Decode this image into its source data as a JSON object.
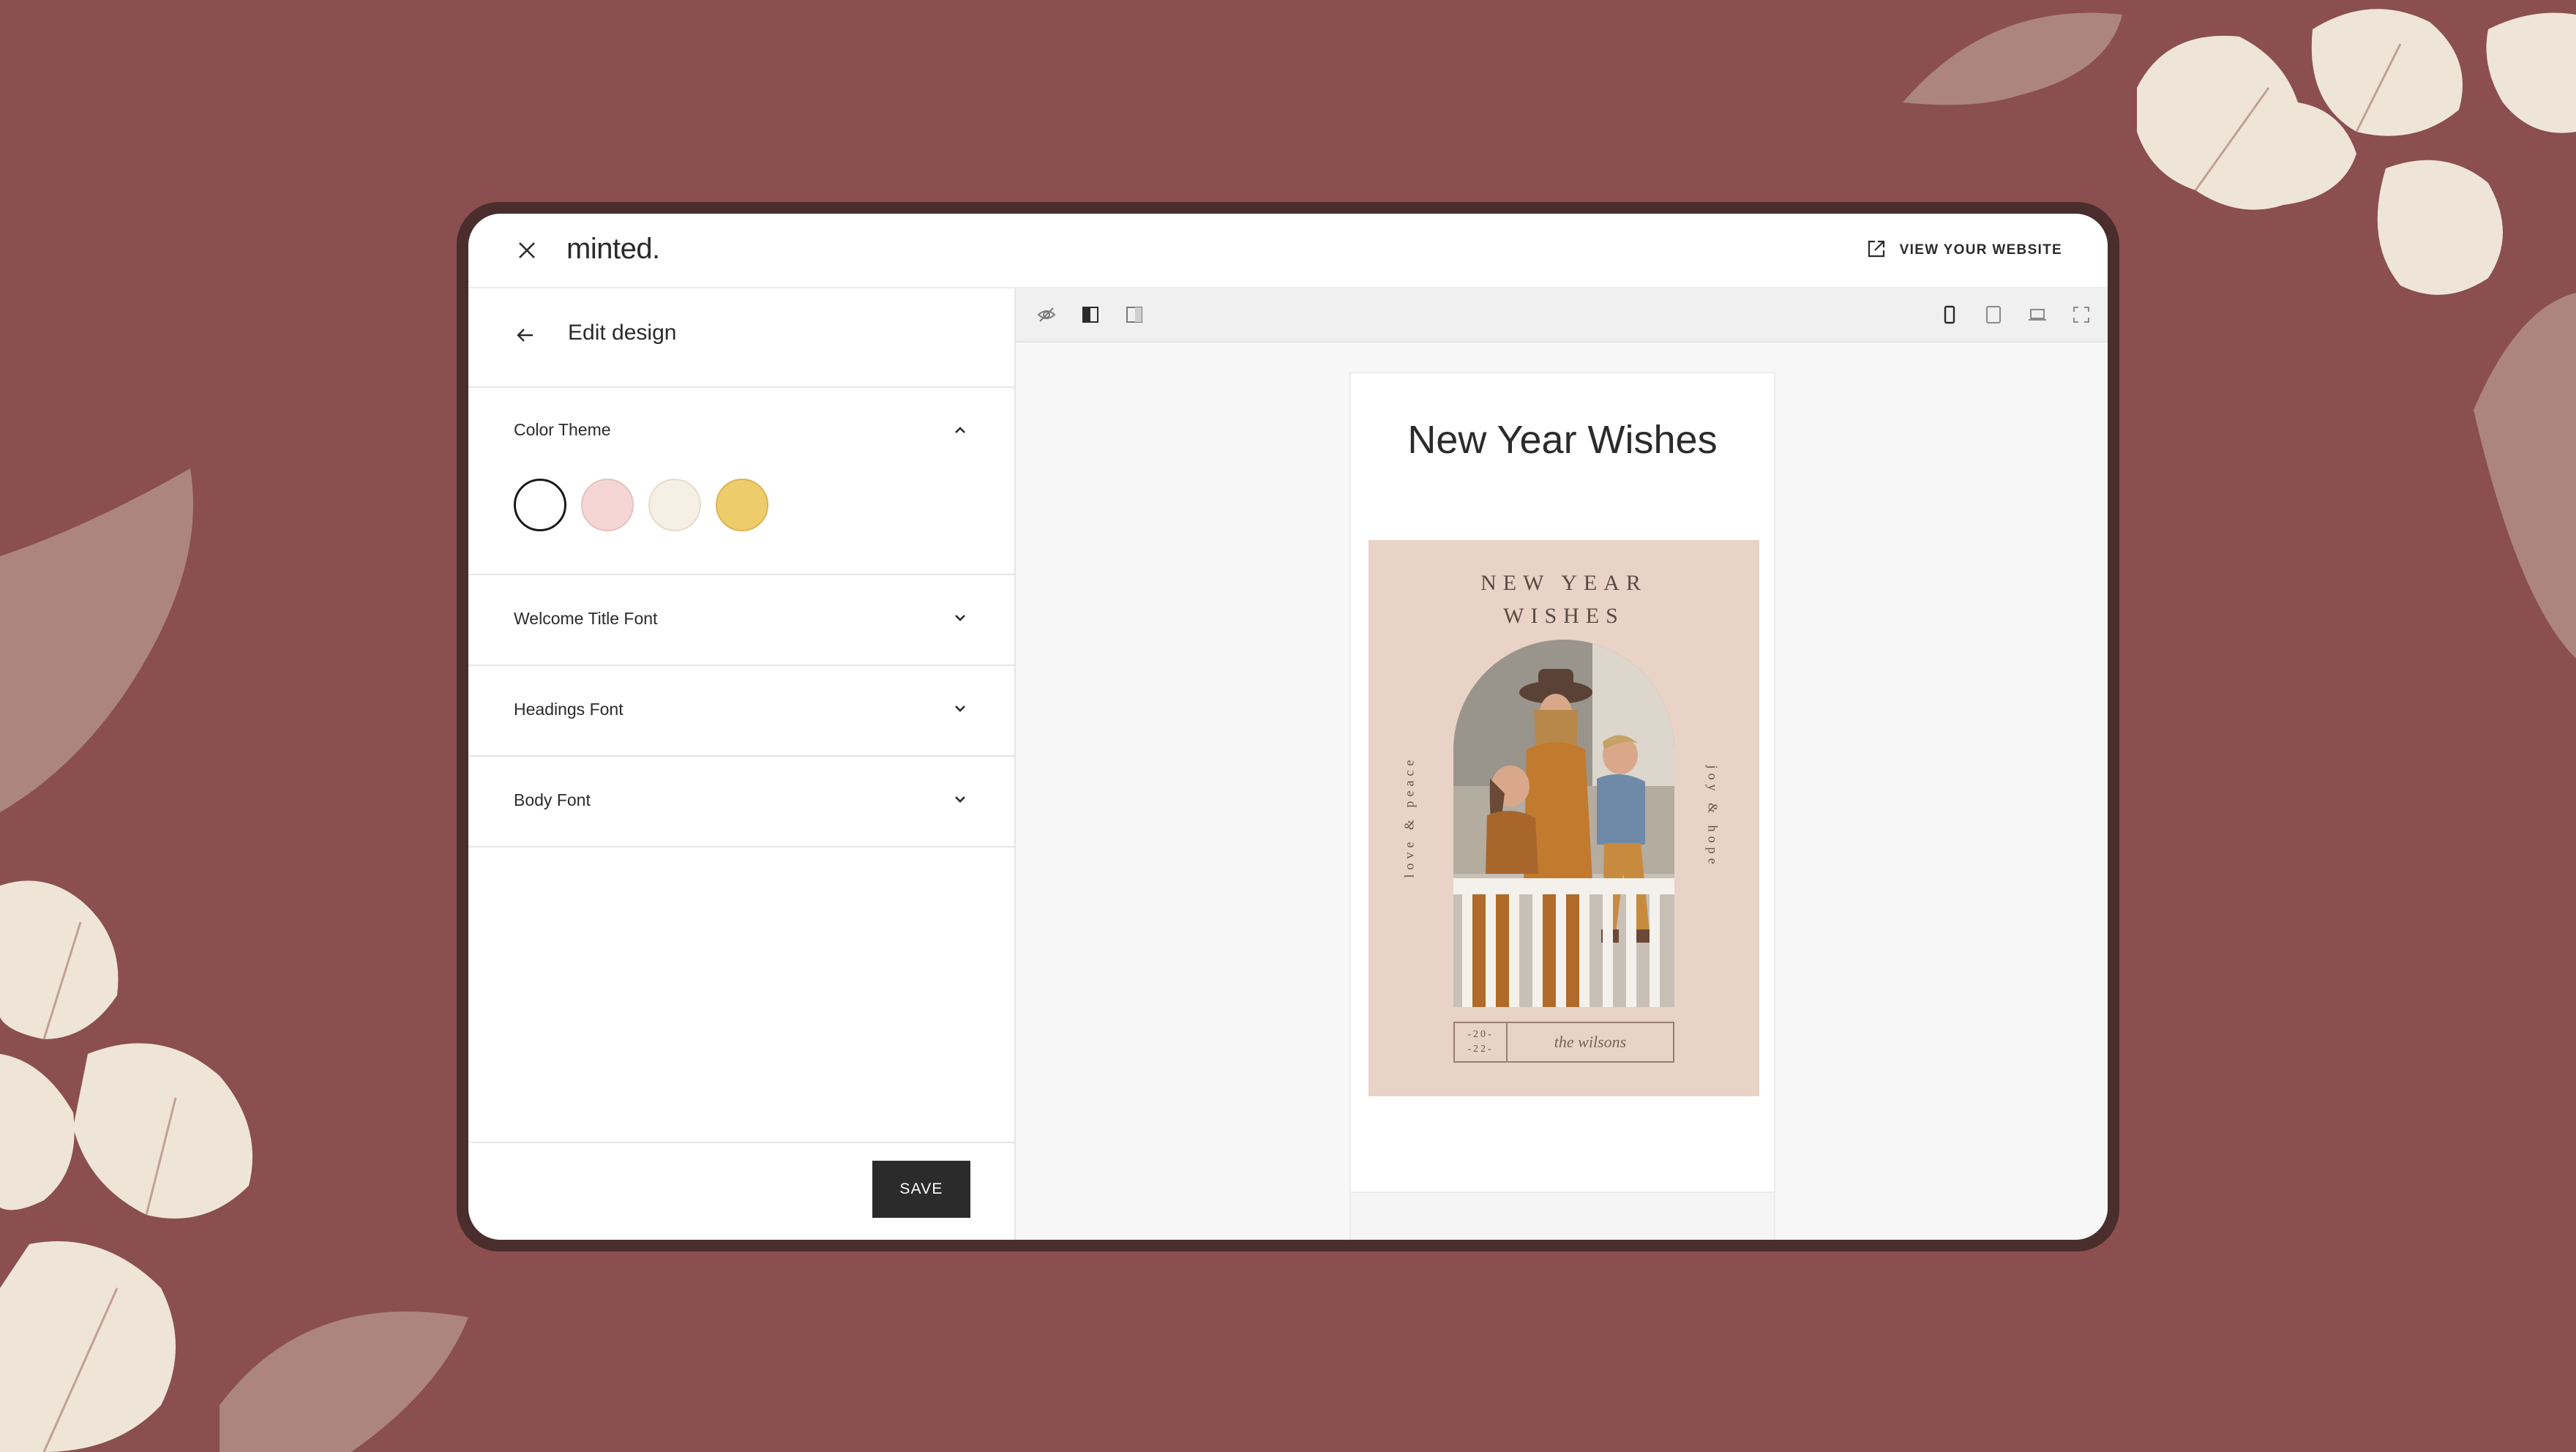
{
  "app": {
    "logo": "minted.",
    "view_website": "VIEW YOUR WEBSITE"
  },
  "sidebar": {
    "title": "Edit design",
    "sections": [
      {
        "label": "Color Theme",
        "expanded": true
      },
      {
        "label": "Welcome Title Font",
        "expanded": false
      },
      {
        "label": "Headings Font",
        "expanded": false
      },
      {
        "label": "Body Font",
        "expanded": false
      }
    ],
    "swatches": [
      "#ffffff",
      "#f6d6d4",
      "#f6efe4",
      "#eecb6b"
    ],
    "selected_swatch": 0,
    "save_label": "SAVE"
  },
  "preview": {
    "page_title": "New Year Wishes",
    "card": {
      "headline_line1": "NEW YEAR",
      "headline_line2": "WISHES",
      "left_text": "love & peace",
      "right_text": "joy & hope",
      "year_line1": "-20-",
      "year_line2": "-22-",
      "signature": "the wilsons"
    }
  },
  "colors": {
    "background": "#8a4f4e",
    "device_frame": "#4a2e2d",
    "card_bg": "#e9d2c6",
    "save_button": "#2b2b2b"
  }
}
